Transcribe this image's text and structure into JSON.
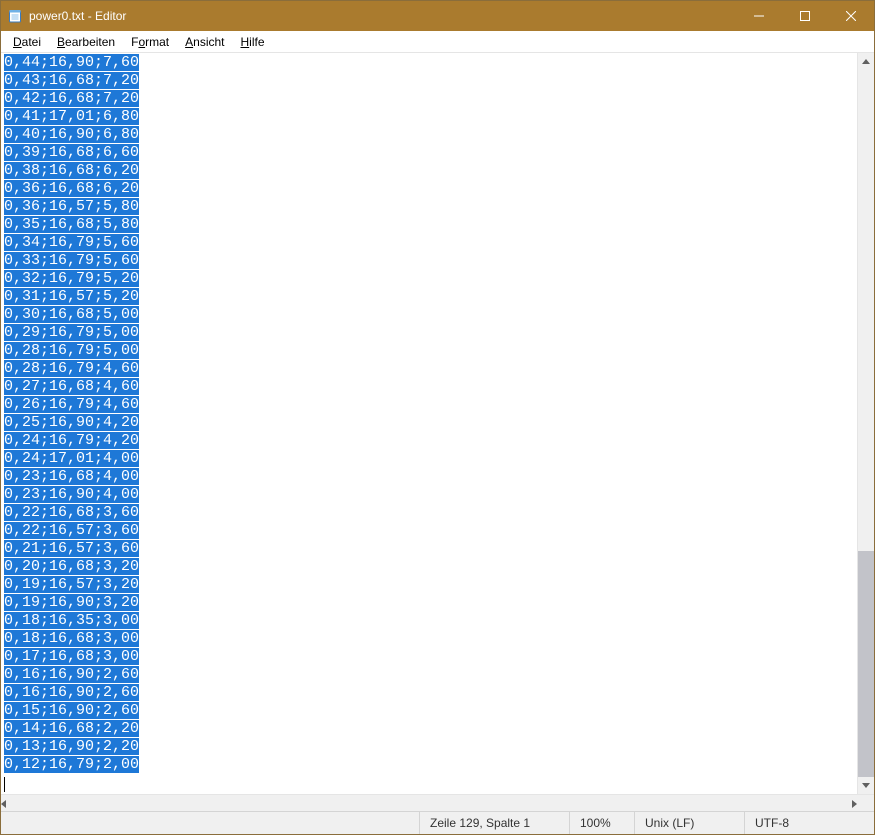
{
  "window": {
    "title": "power0.txt - Editor"
  },
  "menubar": {
    "items": [
      {
        "pre": "",
        "ul": "D",
        "post": "atei"
      },
      {
        "pre": "",
        "ul": "B",
        "post": "earbeiten"
      },
      {
        "pre": "F",
        "ul": "o",
        "post": "rmat"
      },
      {
        "pre": "",
        "ul": "A",
        "post": "nsicht"
      },
      {
        "pre": "",
        "ul": "H",
        "post": "ilfe"
      }
    ]
  },
  "editor": {
    "lines": [
      "0,44;16,90;7,60",
      "0,43;16,68;7,20",
      "0,42;16,68;7,20",
      "0,41;17,01;6,80",
      "0,40;16,90;6,80",
      "0,39;16,68;6,60",
      "0,38;16,68;6,20",
      "0,36;16,68;6,20",
      "0,36;16,57;5,80",
      "0,35;16,68;5,80",
      "0,34;16,79;5,60",
      "0,33;16,79;5,60",
      "0,32;16,79;5,20",
      "0,31;16,57;5,20",
      "0,30;16,68;5,00",
      "0,29;16,79;5,00",
      "0,28;16,79;5,00",
      "0,28;16,79;4,60",
      "0,27;16,68;4,60",
      "0,26;16,79;4,60",
      "0,25;16,90;4,20",
      "0,24;16,79;4,20",
      "0,24;17,01;4,00",
      "0,23;16,68;4,00",
      "0,23;16,90;4,00",
      "0,22;16,68;3,60",
      "0,22;16,57;3,60",
      "0,21;16,57;3,60",
      "0,20;16,68;3,20",
      "0,19;16,57;3,20",
      "0,19;16,90;3,20",
      "0,18;16,35;3,00",
      "0,18;16,68;3,00",
      "0,17;16,68;3,00",
      "0,16;16,90;2,60",
      "0,16;16,90;2,60",
      "0,15;16,90;2,60",
      "0,14;16,68;2,20",
      "0,13;16,90;2,20",
      "0,12;16,79;2,00"
    ],
    "selected": true
  },
  "scrollbar": {
    "vertical_thumb_top_pct": 68,
    "vertical_thumb_height_pct": 32
  },
  "statusbar": {
    "position": "Zeile 129, Spalte 1",
    "zoom": "100%",
    "line_ending": "Unix (LF)",
    "encoding": "UTF-8"
  }
}
